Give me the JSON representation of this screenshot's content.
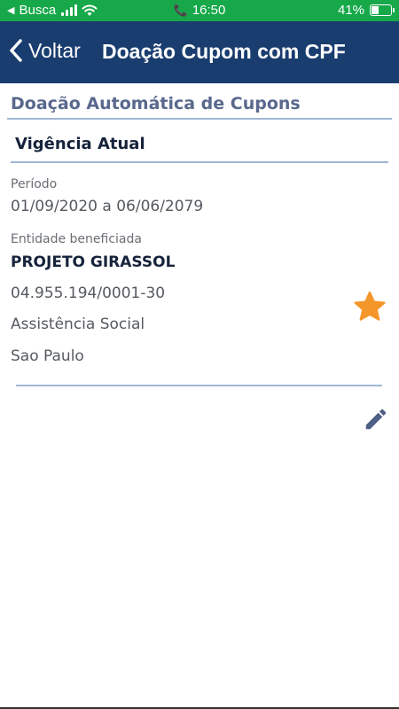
{
  "status_bar": {
    "carrier_back": "Busca",
    "time": "16:50",
    "battery_percent": "41%",
    "battery_level": 0.41
  },
  "nav": {
    "back_label": "Voltar",
    "title": "Doação Cupom com CPF"
  },
  "section": {
    "title": "Doação Automática de Cupons",
    "subtitle": "Vigência Atual"
  },
  "period": {
    "label": "Período",
    "value": "01/09/2020 a 06/06/2079"
  },
  "entity": {
    "label": "Entidade beneficiada",
    "name": "PROJETO GIRASSOL",
    "cnpj": "04.955.194/0001-30",
    "category": "Assistência Social",
    "city": "Sao Paulo"
  },
  "icons": {
    "favorite": "star-icon",
    "edit": "pencil-icon"
  },
  "colors": {
    "status_bar": "#17a84a",
    "nav_bar": "#1a3d6f",
    "section_title": "#59688d",
    "star": "#f5962a",
    "edit": "#4f5f86"
  }
}
